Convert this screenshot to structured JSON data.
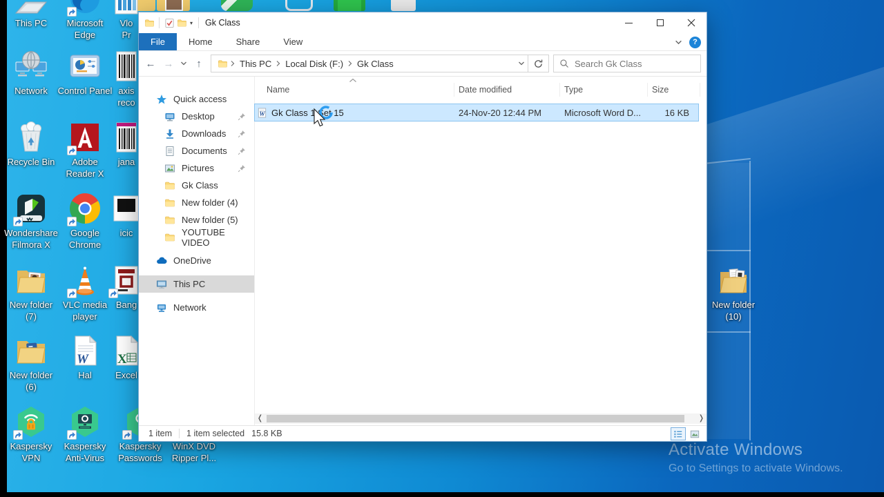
{
  "desktop": {
    "icons": [
      {
        "id": "this-pc",
        "icon": "thispc-cut",
        "col": 1,
        "row": 1,
        "lines": [
          "This PC"
        ]
      },
      {
        "id": "microsoft-edge",
        "icon": "edge",
        "col": 2,
        "row": 1,
        "lines": [
          "Microsoft",
          "Edge"
        ],
        "shortcut": true
      },
      {
        "id": "vlo-pr",
        "icon": "chart",
        "col": 3,
        "row": 1,
        "lines": [
          "Vlo",
          "Pr"
        ]
      },
      {
        "id": "network",
        "icon": "network-big",
        "col": 1,
        "row": 2,
        "lines": [
          "Network"
        ]
      },
      {
        "id": "control-panel",
        "icon": "cpanel",
        "col": 2,
        "row": 2,
        "lines": [
          "Control Panel"
        ]
      },
      {
        "id": "axis-reco",
        "icon": "barcode",
        "col": 3,
        "row": 2,
        "lines": [
          "axis",
          "reco"
        ]
      },
      {
        "id": "recycle-bin",
        "icon": "recycle",
        "col": 1,
        "row": 3,
        "lines": [
          "Recycle Bin"
        ]
      },
      {
        "id": "adobe-reader-x",
        "icon": "adobe",
        "col": 2,
        "row": 3,
        "lines": [
          "Adobe",
          "Reader X"
        ],
        "shortcut": true
      },
      {
        "id": "jana",
        "icon": "barcode2",
        "col": 3,
        "row": 3,
        "lines": [
          "jana"
        ]
      },
      {
        "id": "wondershare-filmora-x",
        "icon": "filmora",
        "col": 1,
        "row": 4,
        "lines": [
          "Wondershare",
          "Filmora X"
        ],
        "shortcut": true
      },
      {
        "id": "google-chrome",
        "icon": "chrome",
        "col": 2,
        "row": 4,
        "lines": [
          "Google",
          "Chrome"
        ],
        "shortcut": true
      },
      {
        "id": "icici",
        "icon": "icici",
        "col": 3,
        "row": 4,
        "lines": [
          "icic"
        ]
      },
      {
        "id": "new-folder-7",
        "icon": "folder-photo",
        "col": 1,
        "row": 5,
        "lines": [
          "New folder",
          "(7)"
        ]
      },
      {
        "id": "vlc-media-player",
        "icon": "vlc",
        "col": 2,
        "row": 5,
        "lines": [
          "VLC media",
          "player"
        ],
        "shortcut": true
      },
      {
        "id": "bang",
        "icon": "bang",
        "col": 3,
        "row": 5,
        "lines": [
          "Bang"
        ],
        "shortcut": true
      },
      {
        "id": "new-folder-6",
        "icon": "folder-blue",
        "col": 1,
        "row": 6,
        "lines": [
          "New folder",
          "(6)"
        ]
      },
      {
        "id": "hal",
        "icon": "word-doc",
        "col": 2,
        "row": 6,
        "lines": [
          "Hal"
        ]
      },
      {
        "id": "excel",
        "icon": "excel-doc",
        "col": 3,
        "row": 6,
        "lines": [
          "Excel"
        ]
      },
      {
        "id": "kaspersky-vpn",
        "icon": "kvpn",
        "col": 1,
        "row": 7,
        "lines": [
          "Kaspersky",
          "VPN"
        ],
        "shortcut": true
      },
      {
        "id": "kaspersky-anti-virus",
        "icon": "kav",
        "col": 2,
        "row": 7,
        "lines": [
          "Kaspersky",
          "Anti-Virus"
        ],
        "shortcut": true
      },
      {
        "id": "kaspersky-passwords",
        "icon": "kpw",
        "col": 3,
        "row": 7,
        "lines": [
          "Kaspersky",
          "Passwords"
        ],
        "shortcut": true
      },
      {
        "id": "winx-dvd",
        "icon": "winx",
        "col": 4,
        "row": 7,
        "lines": [
          "WinX DVD",
          "Ripper Pl..."
        ],
        "shortcut": true
      },
      {
        "id": "new-folder-10",
        "icon": "folder-docs",
        "col": 0,
        "row": 0,
        "lines": [
          "New folder",
          "(10)"
        ]
      }
    ],
    "top_strip": [
      "folder",
      "folder-photo",
      "wps",
      "phone",
      "film",
      "colorful"
    ]
  },
  "watermark": {
    "title": "Activate Windows",
    "subtitle": "Go to Settings to activate Windows."
  },
  "window": {
    "title": "Gk Class",
    "help_label": "?",
    "ribbon": {
      "tabs": [
        "File",
        "Home",
        "Share",
        "View"
      ],
      "active": "File"
    },
    "address": {
      "breadcrumb": [
        "This PC",
        "Local Disk (F:)",
        "Gk Class"
      ]
    },
    "search": {
      "placeholder": "Search Gk Class"
    },
    "sidebar": {
      "items": [
        {
          "icon": "star",
          "label": "Quick access",
          "indent": 0
        },
        {
          "icon": "desktop",
          "label": "Desktop",
          "indent": 1,
          "pinned": true
        },
        {
          "icon": "downloads",
          "label": "Downloads",
          "indent": 1,
          "pinned": true
        },
        {
          "icon": "documents",
          "label": "Documents",
          "indent": 1,
          "pinned": true
        },
        {
          "icon": "pictures",
          "label": "Pictures",
          "indent": 1,
          "pinned": true
        },
        {
          "icon": "folder",
          "label": "Gk Class",
          "indent": 1
        },
        {
          "icon": "folder",
          "label": "New folder (4)",
          "indent": 1
        },
        {
          "icon": "folder",
          "label": "New folder (5)",
          "indent": 1
        },
        {
          "icon": "folder",
          "label": "YOUTUBE VIDEO",
          "indent": 1
        },
        {
          "spacer": true
        },
        {
          "icon": "onedrive",
          "label": "OneDrive",
          "indent": 0
        },
        {
          "spacer": true
        },
        {
          "icon": "thispc",
          "label": "This PC",
          "indent": 0,
          "selected": true
        },
        {
          "spacer": true
        },
        {
          "icon": "network",
          "label": "Network",
          "indent": 0
        }
      ]
    },
    "list": {
      "columns": [
        "Name",
        "Date modified",
        "Type",
        "Size"
      ],
      "rows": [
        {
          "icon": "word",
          "name": "Gk Class 1 Set 15",
          "modified": "24-Nov-20 12:44 PM",
          "type": "Microsoft Word D...",
          "size": "16 KB",
          "selected": true
        }
      ]
    },
    "status": {
      "items": "1 item",
      "selected": "1 item selected",
      "size": "15.8 KB"
    }
  }
}
